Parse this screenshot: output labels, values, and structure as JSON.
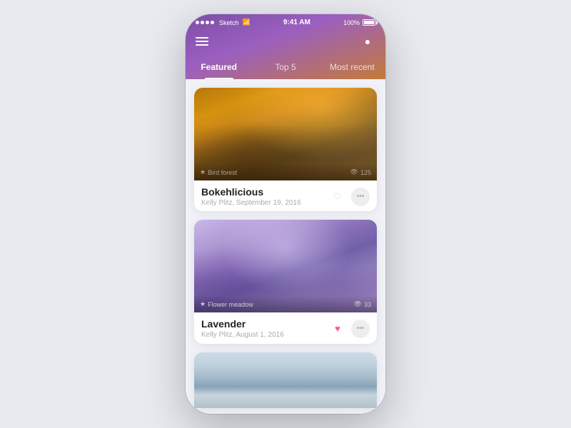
{
  "statusBar": {
    "carrier": "Sketch",
    "wifi": "WiFi",
    "time": "9:41 AM",
    "battery": "100%"
  },
  "tabs": [
    {
      "id": "featured",
      "label": "Featured",
      "active": true
    },
    {
      "id": "top5",
      "label": "Top 5",
      "active": false
    },
    {
      "id": "mostRecent",
      "label": "Most recent",
      "active": false
    }
  ],
  "cards": [
    {
      "id": "bokehlicious",
      "title": "Bokehlicious",
      "subtitle": "Kelly Plitz, September 19, 2016",
      "location": "Bird forest",
      "views": "125",
      "liked": false,
      "imageClass": "card-image-1"
    },
    {
      "id": "lavender",
      "title": "Lavender",
      "subtitle": "Kelly Plitz, August 1, 2016",
      "location": "Flower meadow",
      "views": "33",
      "liked": true,
      "imageClass": "card-image-2"
    },
    {
      "id": "mountain",
      "title": "",
      "subtitle": "",
      "location": "",
      "views": "",
      "liked": false,
      "imageClass": "card-image-3",
      "partial": true
    }
  ],
  "icons": {
    "hamburger": "☰",
    "search": "⌕",
    "pin": "📍",
    "eye": "👁",
    "heart": "♥",
    "more": "···"
  }
}
